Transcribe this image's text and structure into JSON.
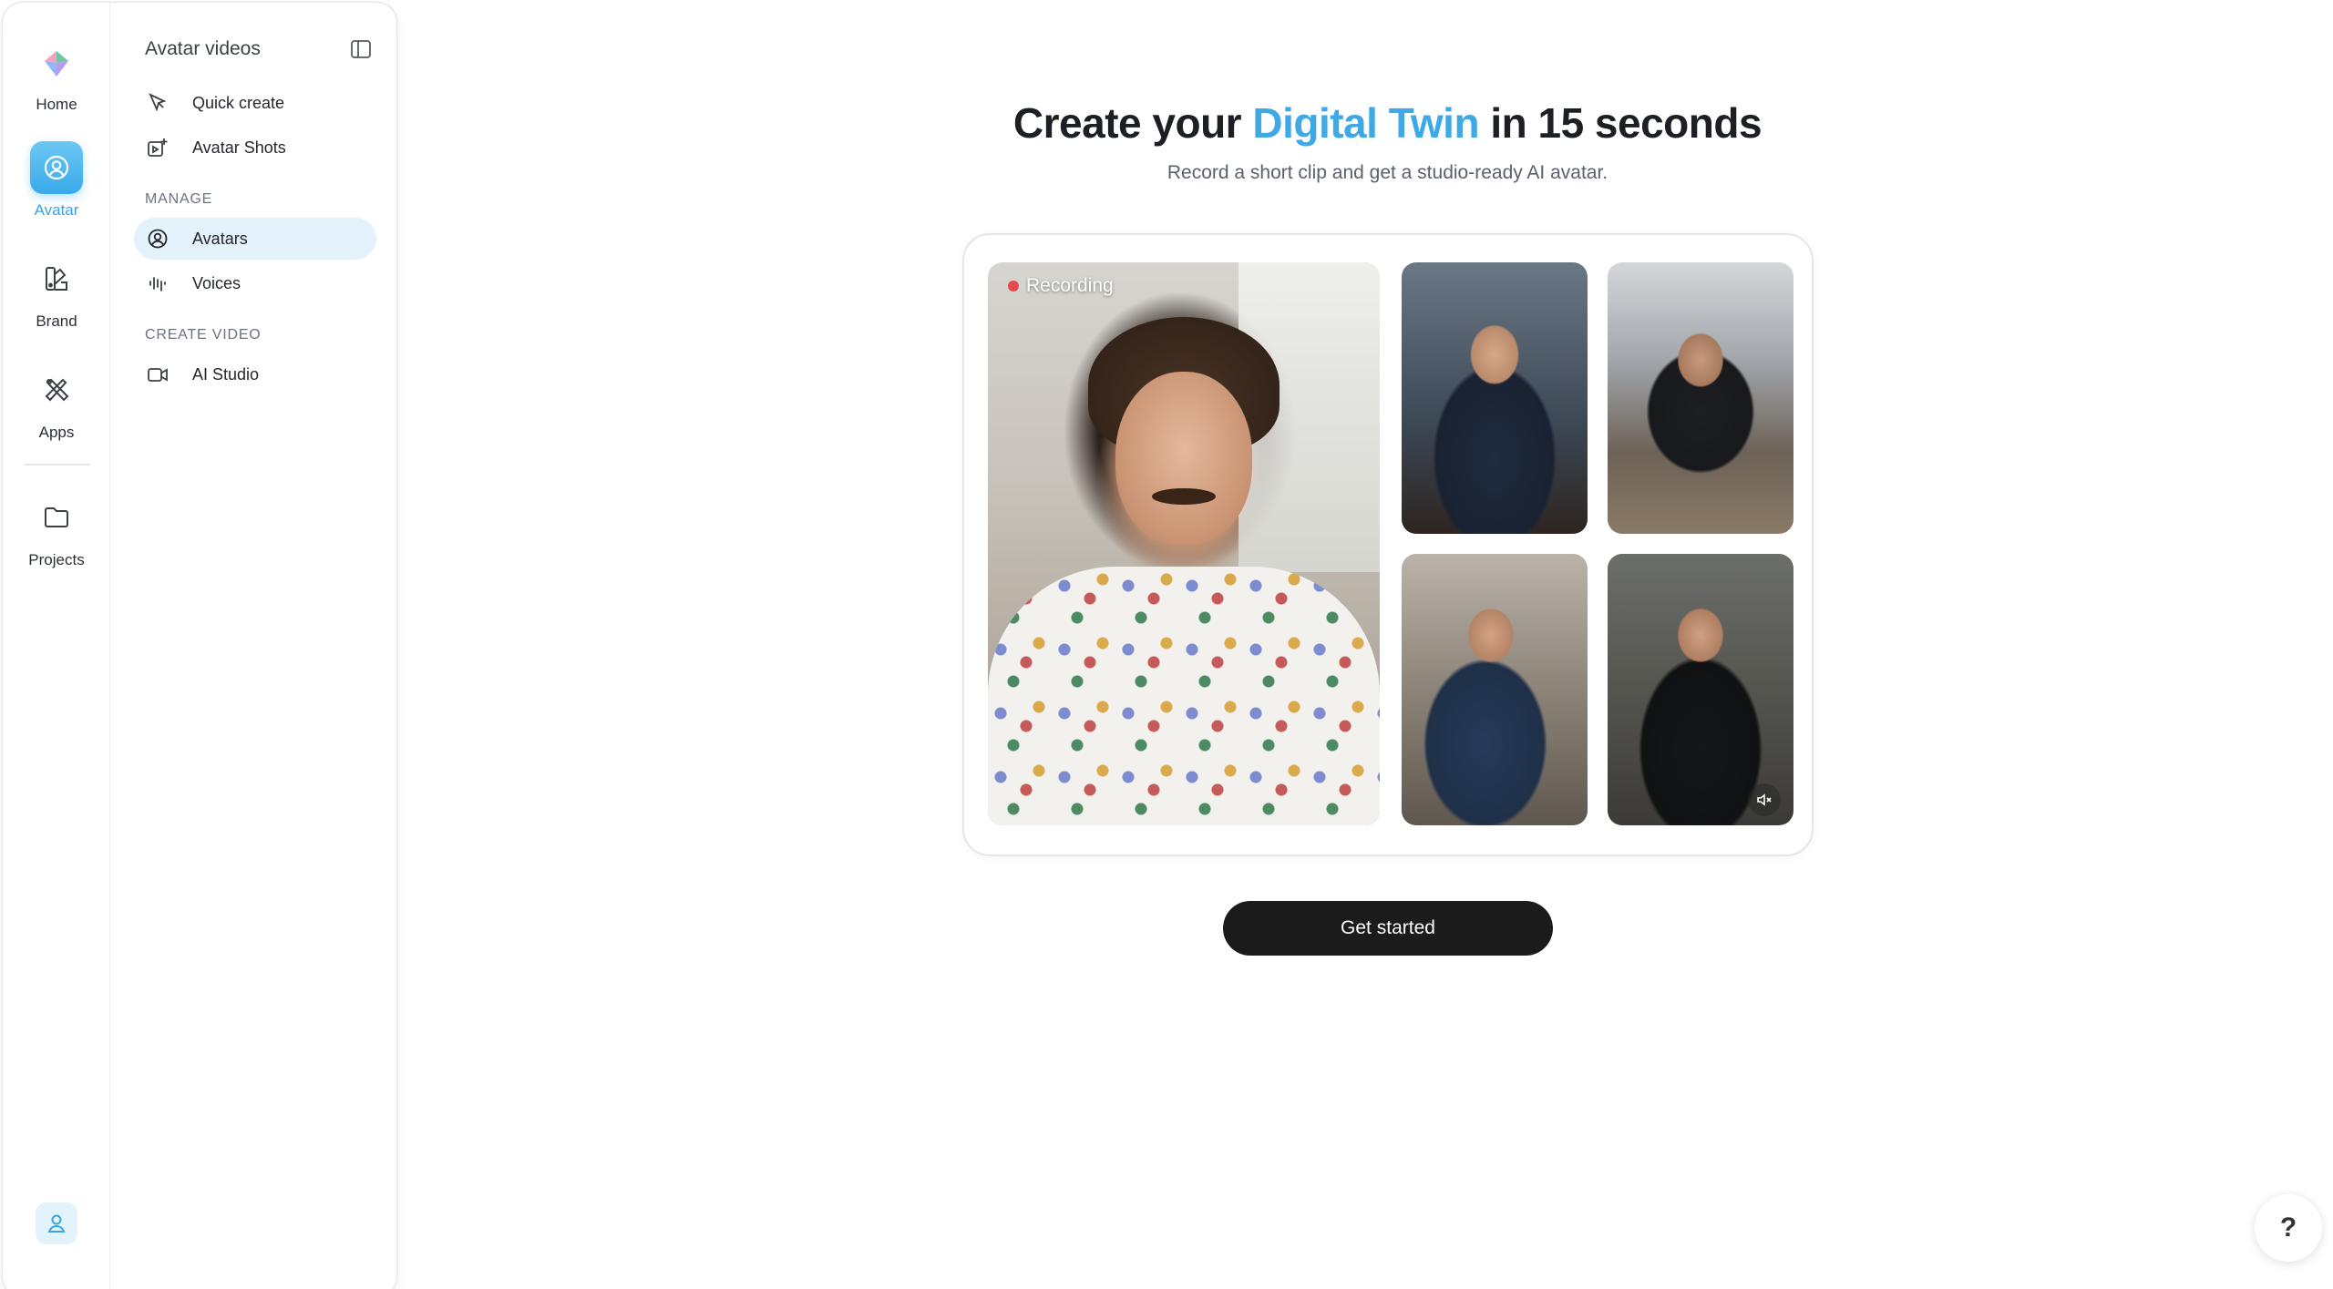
{
  "rail": {
    "items": [
      {
        "label": "Home",
        "icon": "logo-icon"
      },
      {
        "label": "Avatar",
        "icon": "avatar-icon",
        "active": true
      },
      {
        "label": "Brand",
        "icon": "brand-kit-icon"
      },
      {
        "label": "Apps",
        "icon": "apps-icon"
      },
      {
        "label": "Projects",
        "icon": "folder-icon"
      }
    ],
    "accent_color": "#3aa4e2"
  },
  "subnav": {
    "title": "Avatar videos",
    "items_top": [
      {
        "label": "Quick create",
        "icon": "cursor-icon"
      },
      {
        "label": "Avatar Shots",
        "icon": "image-plus-icon"
      }
    ],
    "manage_label": "MANAGE",
    "manage_items": [
      {
        "label": "Avatars",
        "icon": "avatar-circle-icon",
        "active": true
      },
      {
        "label": "Voices",
        "icon": "waveform-icon"
      }
    ],
    "create_label": "CREATE VIDEO",
    "create_items": [
      {
        "label": "AI Studio",
        "icon": "video-camera-icon"
      }
    ]
  },
  "hero": {
    "title_prefix": "Create your ",
    "title_highlight": "Digital Twin",
    "title_suffix": " in 15 seconds",
    "subtitle": "Record a short clip and get a studio-ready AI avatar.",
    "highlight_color": "#3fa9e6"
  },
  "preview": {
    "recording_label": "Recording"
  },
  "cta": {
    "label": "Get started"
  },
  "help": {
    "label": "?"
  }
}
